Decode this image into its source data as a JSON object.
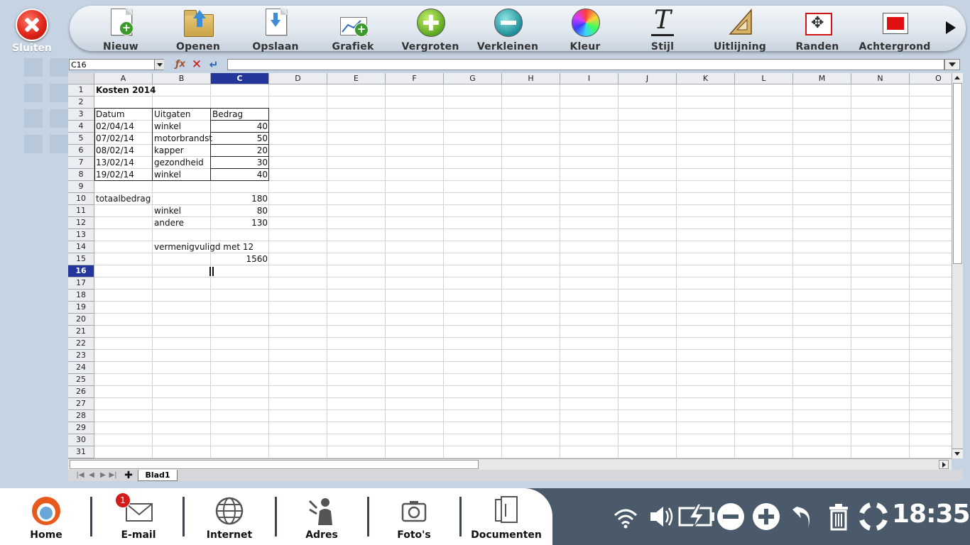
{
  "app": {
    "close_label": "Sluiten"
  },
  "toolbar": {
    "items": [
      {
        "id": "nieuw",
        "label": "Nieuw",
        "icon": "new-document-icon"
      },
      {
        "id": "openen",
        "label": "Openen",
        "icon": "open-folder-icon"
      },
      {
        "id": "opslaan",
        "label": "Opslaan",
        "icon": "save-icon"
      },
      {
        "id": "grafiek",
        "label": "Grafiek",
        "icon": "chart-icon"
      },
      {
        "id": "vergroten",
        "label": "Vergroten",
        "icon": "zoom-in-icon"
      },
      {
        "id": "verkleinen",
        "label": "Verkleinen",
        "icon": "zoom-out-icon"
      },
      {
        "id": "kleur",
        "label": "Kleur",
        "icon": "color-wheel-icon"
      },
      {
        "id": "stijl",
        "label": "Stijl",
        "icon": "text-style-icon"
      },
      {
        "id": "uitlijning",
        "label": "Uitlijning",
        "icon": "alignment-icon"
      },
      {
        "id": "randen",
        "label": "Randen",
        "icon": "borders-icon"
      },
      {
        "id": "achtergrond",
        "label": "Achtergrond",
        "icon": "background-icon"
      }
    ]
  },
  "formula_bar": {
    "cell_ref": "C16",
    "formula": ""
  },
  "grid": {
    "columns": [
      "A",
      "B",
      "C",
      "D",
      "E",
      "F",
      "G",
      "H",
      "I",
      "J",
      "K",
      "L",
      "M",
      "N",
      "O"
    ],
    "selected_column": "C",
    "rows": [
      1,
      2,
      3,
      4,
      5,
      6,
      7,
      8,
      9,
      10,
      11,
      12,
      13,
      14,
      15,
      16,
      17,
      18,
      19,
      20,
      21,
      22,
      23,
      24,
      25,
      26,
      27,
      28,
      29,
      30,
      31
    ],
    "selected_row": 16,
    "cells": [
      {
        "ref": "A1",
        "value": "Kosten 2014",
        "bold": true
      },
      {
        "ref": "A3",
        "value": "Datum"
      },
      {
        "ref": "B3",
        "value": "Uitgaten"
      },
      {
        "ref": "C3",
        "value": "Bedrag"
      },
      {
        "ref": "A4",
        "value": "02/04/14"
      },
      {
        "ref": "B4",
        "value": "winkel"
      },
      {
        "ref": "C4",
        "value": "40",
        "align": "right"
      },
      {
        "ref": "A5",
        "value": "07/02/14"
      },
      {
        "ref": "B5",
        "value": "motorbrandst"
      },
      {
        "ref": "C5",
        "value": "50",
        "align": "right"
      },
      {
        "ref": "A6",
        "value": "08/02/14"
      },
      {
        "ref": "B6",
        "value": "kapper"
      },
      {
        "ref": "C6",
        "value": "20",
        "align": "right"
      },
      {
        "ref": "A7",
        "value": "13/02/14"
      },
      {
        "ref": "B7",
        "value": "gezondheid"
      },
      {
        "ref": "C7",
        "value": "30",
        "align": "right"
      },
      {
        "ref": "A8",
        "value": "19/02/14"
      },
      {
        "ref": "B8",
        "value": "winkel"
      },
      {
        "ref": "C8",
        "value": "40",
        "align": "right"
      },
      {
        "ref": "A10",
        "value": "totaalbedrag"
      },
      {
        "ref": "C10",
        "value": "180",
        "align": "right"
      },
      {
        "ref": "B11",
        "value": "winkel"
      },
      {
        "ref": "C11",
        "value": "80",
        "align": "right"
      },
      {
        "ref": "B12",
        "value": "andere"
      },
      {
        "ref": "C12",
        "value": "130",
        "align": "right"
      },
      {
        "ref": "B14",
        "value": "vermenigvuligd met 12"
      },
      {
        "ref": "C15",
        "value": "1560",
        "align": "right"
      }
    ]
  },
  "sheet_tabs": {
    "active": "Blad1",
    "tabs": [
      "Blad1"
    ]
  },
  "taskbar": {
    "items": [
      {
        "id": "home",
        "label": "Home",
        "icon": "home-logo-icon"
      },
      {
        "id": "email",
        "label": "E-mail",
        "icon": "envelope-icon",
        "badge": "1"
      },
      {
        "id": "internet",
        "label": "Internet",
        "icon": "globe-icon"
      },
      {
        "id": "adres",
        "label": "Adres",
        "icon": "contacts-icon"
      },
      {
        "id": "fotos",
        "label": "Foto's",
        "icon": "camera-icon"
      },
      {
        "id": "documenten",
        "label": "Documenten",
        "icon": "documents-icon"
      }
    ],
    "tray": [
      "wifi-icon",
      "volume-icon",
      "battery-charging-icon",
      "minus-icon",
      "plus-icon",
      "undo-icon",
      "trash-icon",
      "help-lifebuoy-icon"
    ],
    "clock": "18:35"
  },
  "colors": {
    "selection": "#24359c",
    "close": "#e0261a",
    "taskbar": "#4a5a6b"
  }
}
